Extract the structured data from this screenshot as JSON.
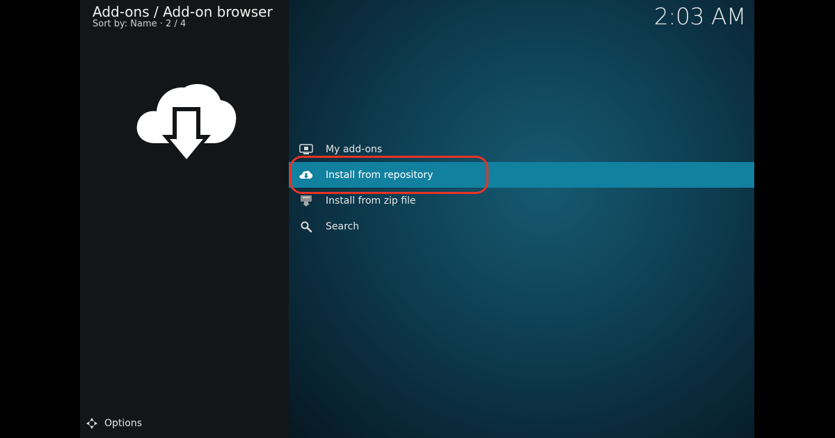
{
  "header": {
    "title": "Add-ons / Add-on browser",
    "subtitle": "Sort by: Name  ·  2 / 4"
  },
  "clock": "2:03 AM",
  "menu": {
    "items": [
      {
        "label": "My add-ons",
        "icon": "tv-box-icon"
      },
      {
        "label": "Install from repository",
        "icon": "cloud-download-icon",
        "focused": true
      },
      {
        "label": "Install from zip file",
        "icon": "zip-file-icon"
      },
      {
        "label": "Search",
        "icon": "search-icon"
      }
    ]
  },
  "footer": {
    "options_label": "Options"
  },
  "colors": {
    "focus_bar": "#12809f",
    "highlight_ring": "#e83324",
    "left_panel": "#141516"
  }
}
